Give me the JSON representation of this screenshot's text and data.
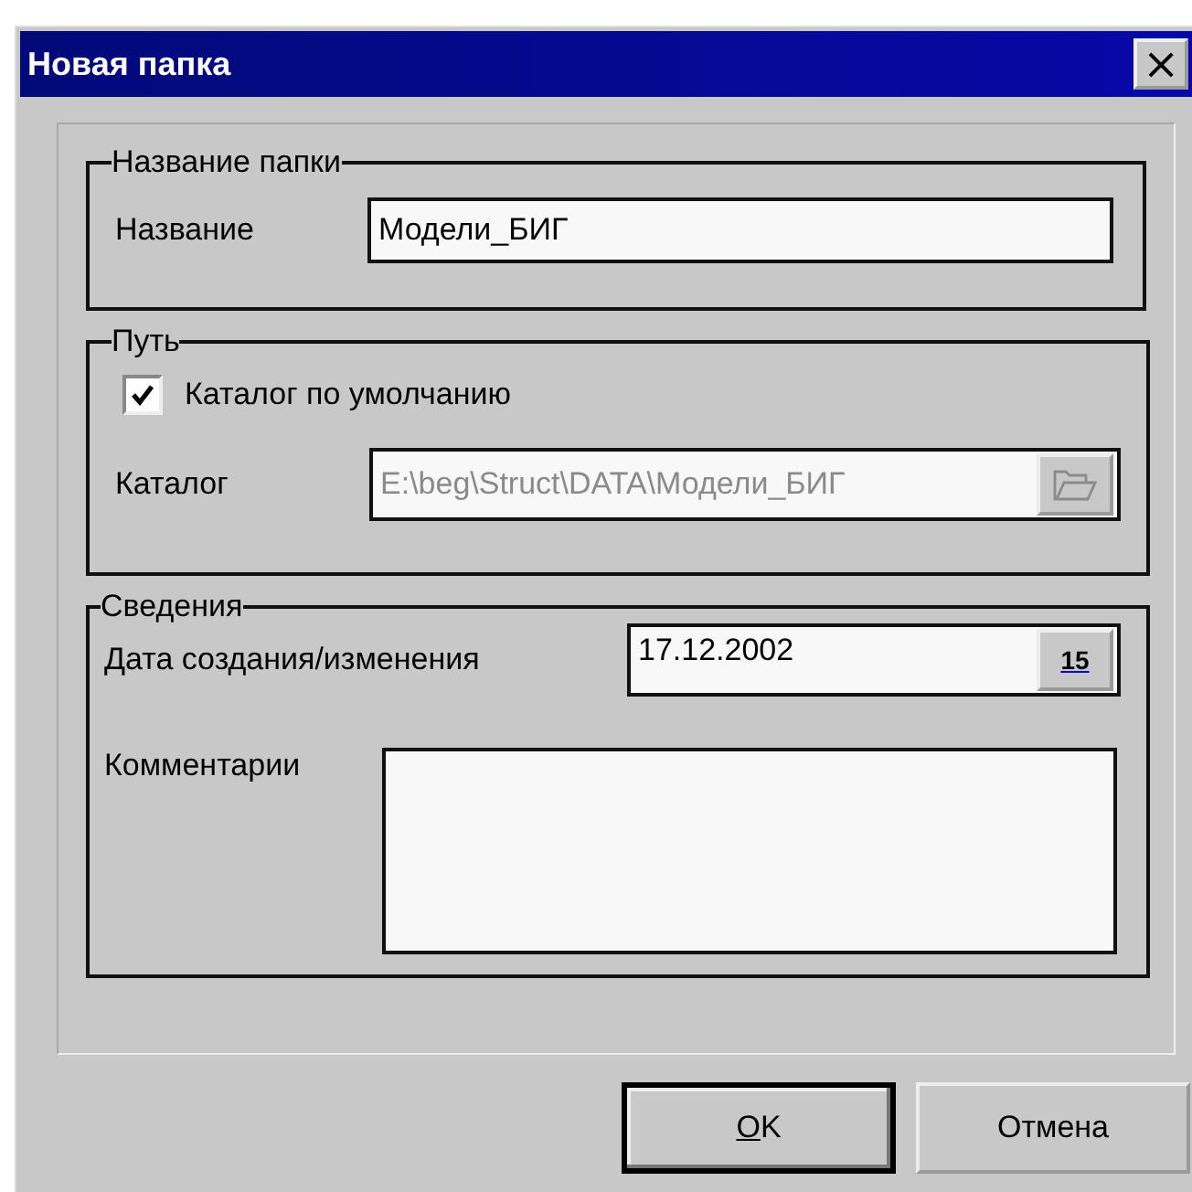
{
  "window": {
    "title": "Новая папка",
    "close": "×"
  },
  "name_group": {
    "title": "Название папки",
    "label": "Название",
    "value": "Модели_БИГ"
  },
  "path_group": {
    "title": "Путь",
    "checkbox": {
      "label": "Каталог по умолчанию",
      "checked": true
    },
    "catalog": {
      "label": "Каталог",
      "value": "E:\\beg\\Struct\\DATA\\Модели_БИГ",
      "disabled": true
    }
  },
  "info_group": {
    "title": "Сведения",
    "date": {
      "label": "Дата создания/изменения",
      "value": "17.12.2002",
      "button": "15"
    },
    "comments": {
      "label": "Комментарии"
    }
  },
  "buttons": [
    {
      "label": "OK",
      "default": true,
      "mnemonic": true
    },
    {
      "label": "Отмена",
      "default": false,
      "mnemonic": false
    }
  ]
}
